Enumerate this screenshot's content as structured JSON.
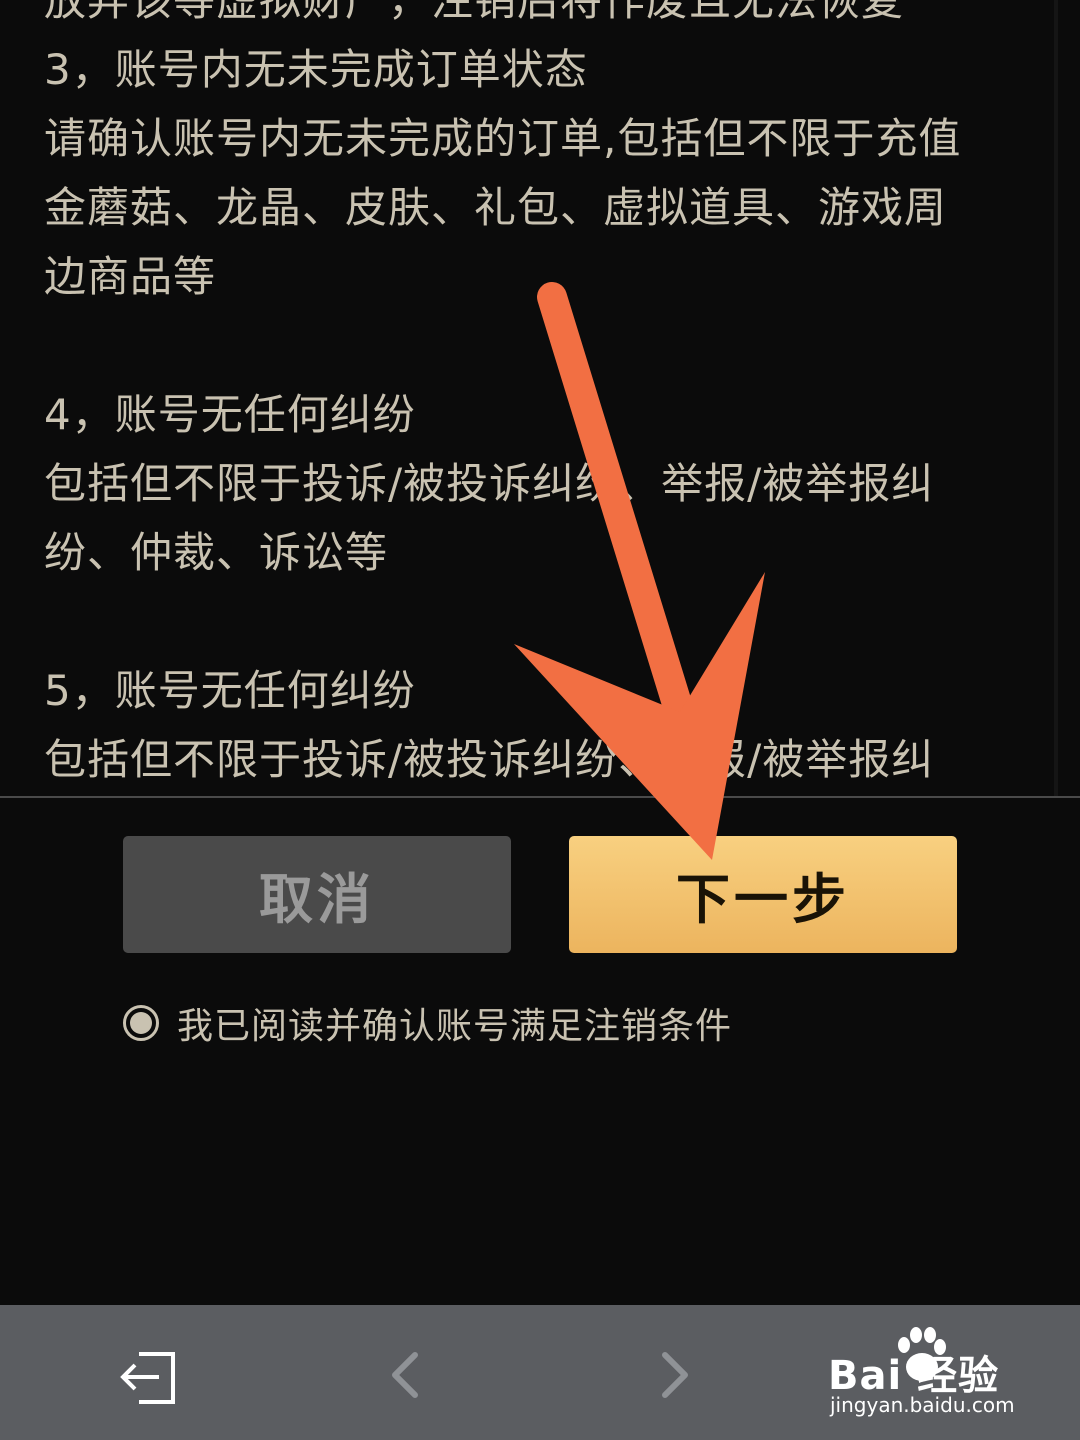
{
  "terms": {
    "lines": [
      "放弃该等虚拟财产，注销后将作废且无法恢复",
      "3，账号内无未完成订单状态",
      "请确认账号内无未完成的订单,包括但不限于充值",
      "金蘑菇、龙晶、皮肤、礼包、虚拟道具、游戏周",
      "边商品等",
      "4，账号无任何纠纷",
      "包括但不限于投诉/被投诉纠纷、举报/被举报纠",
      "纷、仲裁、诉讼等",
      "5，账号无任何纠纷",
      "包括但不限于投诉/被投诉纠纷、举报/被举报纠"
    ]
  },
  "actions": {
    "cancel_label": "取消",
    "next_label": "下一步"
  },
  "agreement": {
    "label": "我已阅读并确认账号满足注销条件",
    "checked": true
  },
  "watermark": {
    "brand": "Bai 经验",
    "url": "jingyan.baidu.com"
  },
  "colors": {
    "background": "#0b0b0b",
    "text": "#c9c2b1",
    "cancel_bg": "#4a4a4a",
    "next_bg": "#f0bd66",
    "annotation_arrow": "#f26f43",
    "nav_bar": "#5b5d61"
  },
  "icons": {
    "exit": "exit-icon",
    "back": "chevron-left-icon",
    "forward": "chevron-right-icon",
    "annotation": "arrow-annotation"
  }
}
